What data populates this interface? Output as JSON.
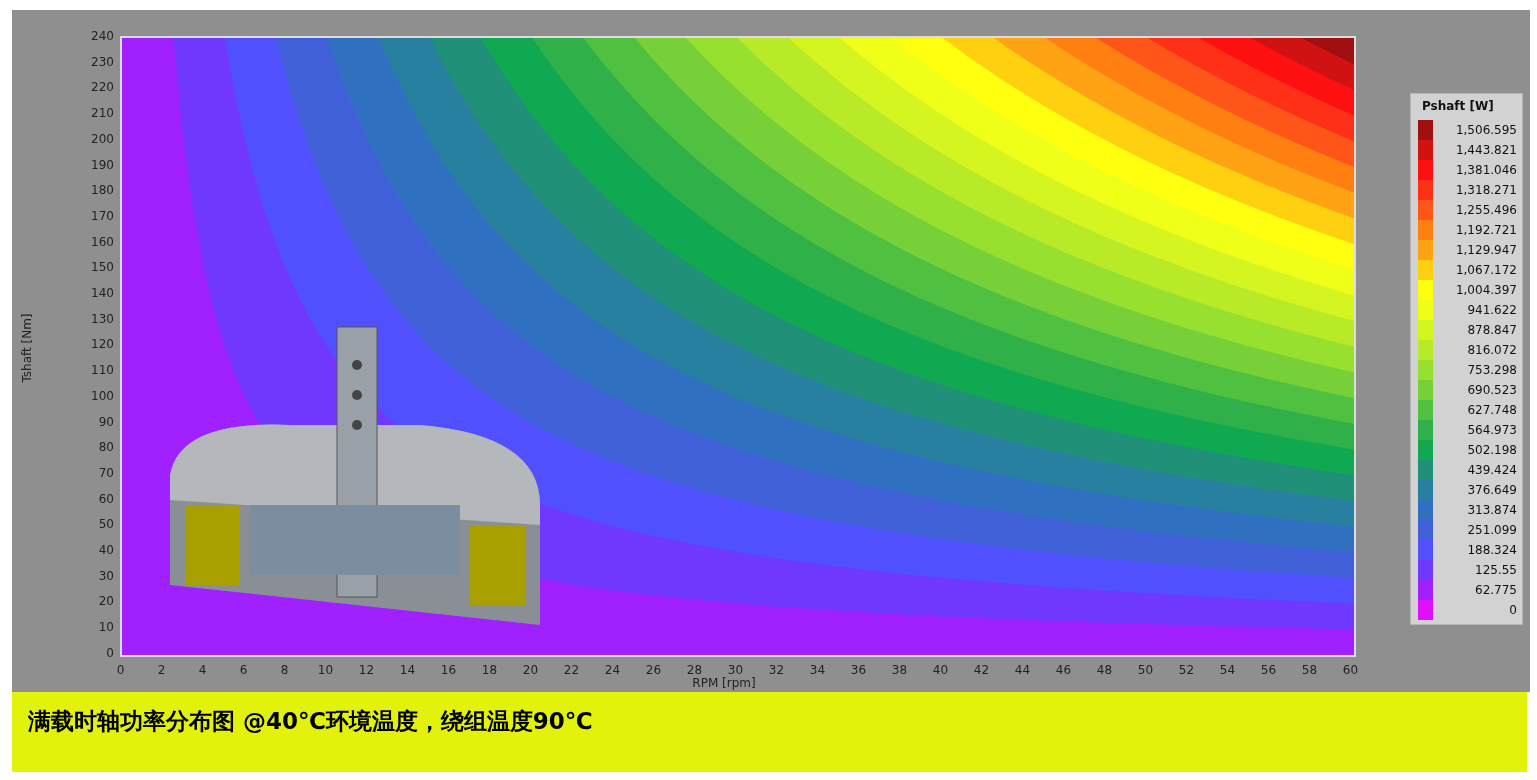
{
  "chart": {
    "y_axis": {
      "title": "Tshaft [Nm]",
      "ticks": [
        "240",
        "230",
        "220",
        "210",
        "200",
        "190",
        "180",
        "170",
        "160",
        "150",
        "140",
        "130",
        "120",
        "110",
        "100",
        "90",
        "80",
        "70",
        "60",
        "50",
        "40",
        "30",
        "20",
        "10",
        "0"
      ]
    },
    "x_axis": {
      "title": "RPM [rpm]",
      "ticks": [
        "0",
        "2",
        "4",
        "6",
        "8",
        "10",
        "12",
        "14",
        "16",
        "18",
        "20",
        "22",
        "24",
        "26",
        "28",
        "30",
        "32",
        "34",
        "36",
        "38",
        "40",
        "42",
        "44",
        "46",
        "48",
        "50",
        "52",
        "54",
        "56",
        "58",
        "60"
      ]
    },
    "legend": {
      "title": "Pshaft [W]",
      "items": [
        {
          "label": "1,506.595",
          "color": "#a01010"
        },
        {
          "label": "1,443.821",
          "color": "#d01212"
        },
        {
          "label": "1,381.046",
          "color": "#ff1010"
        },
        {
          "label": "1,318.271",
          "color": "#ff3018"
        },
        {
          "label": "1,255.496",
          "color": "#ff5518"
        },
        {
          "label": "1,192.721",
          "color": "#ff8010"
        },
        {
          "label": "1,129.947",
          "color": "#ffa214"
        },
        {
          "label": "1,067.172",
          "color": "#ffd010"
        },
        {
          "label": "1,004.397",
          "color": "#ffff10"
        },
        {
          "label": "941.622",
          "color": "#f0ff18"
        },
        {
          "label": "878.847",
          "color": "#d4f520"
        },
        {
          "label": "816.072",
          "color": "#b8ea28"
        },
        {
          "label": "753.298",
          "color": "#98e030"
        },
        {
          "label": "690.523",
          "color": "#78d038"
        },
        {
          "label": "627.748",
          "color": "#50c040"
        },
        {
          "label": "564.973",
          "color": "#30b048"
        },
        {
          "label": "502.198",
          "color": "#10a850"
        },
        {
          "label": "439.424",
          "color": "#209078"
        },
        {
          "label": "376.649",
          "color": "#2880a0"
        },
        {
          "label": "313.874",
          "color": "#3070c0"
        },
        {
          "label": "251.099",
          "color": "#4060d8"
        },
        {
          "label": "188.324",
          "color": "#5050ff"
        },
        {
          "label": "125.55",
          "color": "#7038ff"
        },
        {
          "label": "62.775",
          "color": "#a020ff"
        },
        {
          "label": "0",
          "color": "#e010ff"
        }
      ]
    }
  },
  "caption": "满载时轴功率分布图 @40℃环境温度，绕组温度90℃"
}
